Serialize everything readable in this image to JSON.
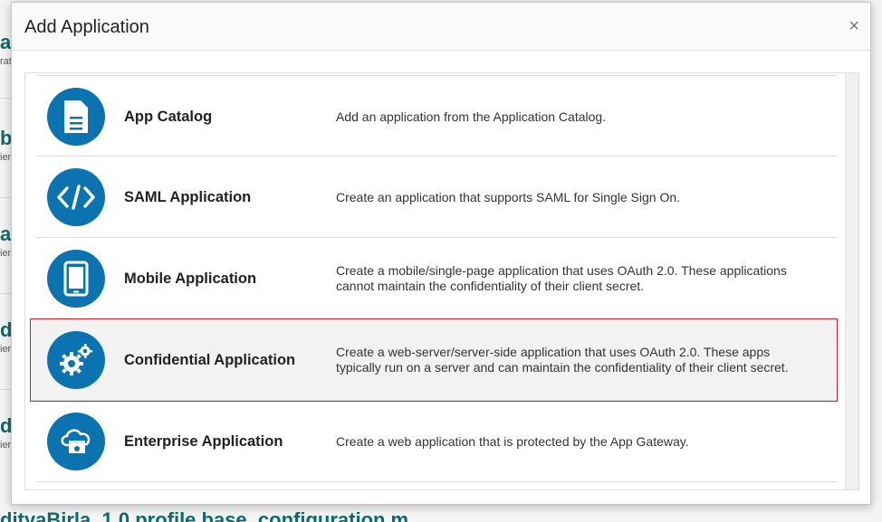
{
  "background": {
    "fragments": [
      {
        "title": "afi",
        "sub": "rat"
      },
      {
        "title": "b",
        "sub": "ien"
      },
      {
        "title": "ac",
        "sub": "ien"
      },
      {
        "title": "d",
        "sub": "ien"
      },
      {
        "title": "d",
        "sub": "ien"
      }
    ],
    "footer_text": "dityaBirla_1.0 profile base_configuration m"
  },
  "modal": {
    "title": "Add Application",
    "close_label": "×"
  },
  "applications": [
    {
      "name": "App Catalog",
      "description": "Add an application from the Application Catalog.",
      "icon": "document-icon",
      "selected": false
    },
    {
      "name": "SAML Application",
      "description": "Create an application that supports SAML for Single Sign On.",
      "icon": "code-icon",
      "selected": false
    },
    {
      "name": "Mobile Application",
      "description": "Create a mobile/single-page application that uses OAuth 2.0. These applications cannot maintain the confidentiality of their client secret.",
      "icon": "tablet-icon",
      "selected": false
    },
    {
      "name": "Confidential Application",
      "description": "Create a web-server/server-side application that uses OAuth 2.0. These apps typically run on a server and can maintain the confidentiality of their client secret.",
      "icon": "gears-icon",
      "selected": true
    },
    {
      "name": "Enterprise Application",
      "description": "Create a web application that is protected by the App Gateway.",
      "icon": "cloud-app-icon",
      "selected": false
    }
  ],
  "colors": {
    "icon_circle": "#0b74b0",
    "selected_outline": "#c0262d",
    "background_link": "#106a6a"
  }
}
